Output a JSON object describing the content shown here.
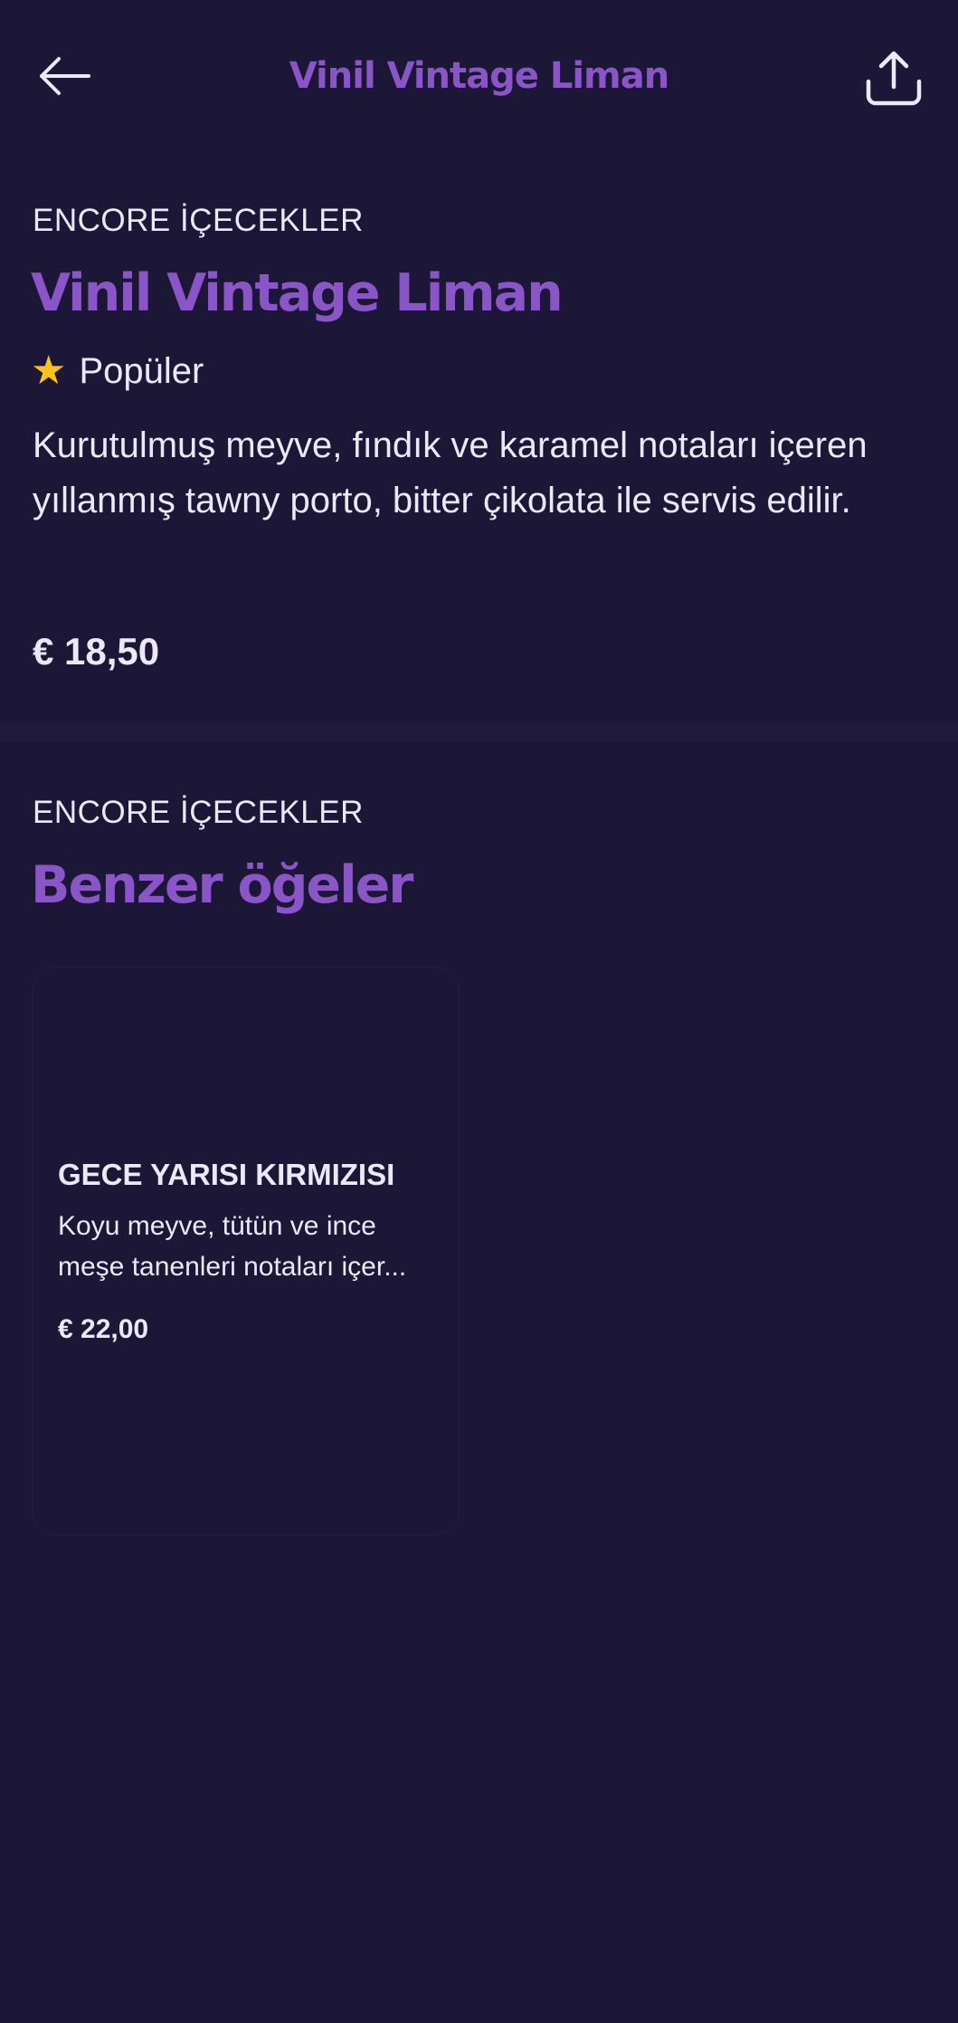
{
  "header": {
    "title": "Vinil Vintage Liman",
    "back_icon": "arrow-left-icon",
    "share_icon": "share-icon"
  },
  "item": {
    "category": "ENCORE İÇECEKLER",
    "name": "Vinil Vintage Liman",
    "badge_icon": "star-icon",
    "badge": "Popüler",
    "description": "Kurutulmuş meyve, fındık ve karamel notaları içeren yıllanmış tawny porto, bitter çikolata ile servis edilir.",
    "price": "€ 18,50"
  },
  "similar": {
    "category": "ENCORE İÇECEKLER",
    "title": "Benzer öğeler",
    "items": [
      {
        "name": "GECE YARISI KIRMIZISI",
        "description": "Koyu meyve, tütün ve ince meşe tanenleri notaları içer...",
        "price": "€ 22,00"
      }
    ]
  },
  "colors": {
    "background": "#1c1637",
    "accent": "#8a55c6",
    "text": "#ece8f7",
    "star": "#f7c31c"
  }
}
